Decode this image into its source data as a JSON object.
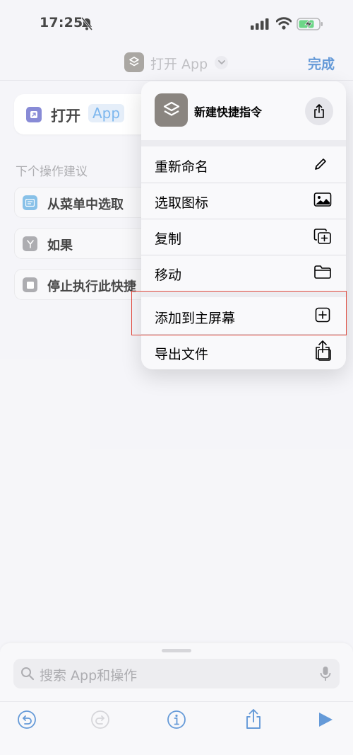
{
  "status": {
    "time": "17:25"
  },
  "nav": {
    "title": "打开 App",
    "done": "完成"
  },
  "action": {
    "verb": "打开",
    "param": "App"
  },
  "suggestions": {
    "header": "下个操作建议",
    "items": [
      {
        "label": "从菜单中选取",
        "color": "#5aa9e0"
      },
      {
        "label": "如果",
        "color": "#8e8e93"
      },
      {
        "label": "停止执行此快捷",
        "color": "#8e8e93"
      }
    ]
  },
  "menu": {
    "title": "新建快捷指令",
    "items": [
      {
        "label": "重新命名",
        "icon": "pencil-icon"
      },
      {
        "label": "选取图标",
        "icon": "image-icon"
      },
      {
        "label": "复制",
        "icon": "duplicate-icon"
      },
      {
        "label": "移动",
        "icon": "folder-icon"
      },
      {
        "label": "添加到主屏幕",
        "icon": "plus-square-icon"
      },
      {
        "label": "导出文件",
        "icon": "export-icon"
      }
    ]
  },
  "search": {
    "placeholder": "搜索 App和操作"
  },
  "colors": {
    "accent": "#2a74c9",
    "highlight": "#e0473a",
    "play": "#2a74c9"
  }
}
